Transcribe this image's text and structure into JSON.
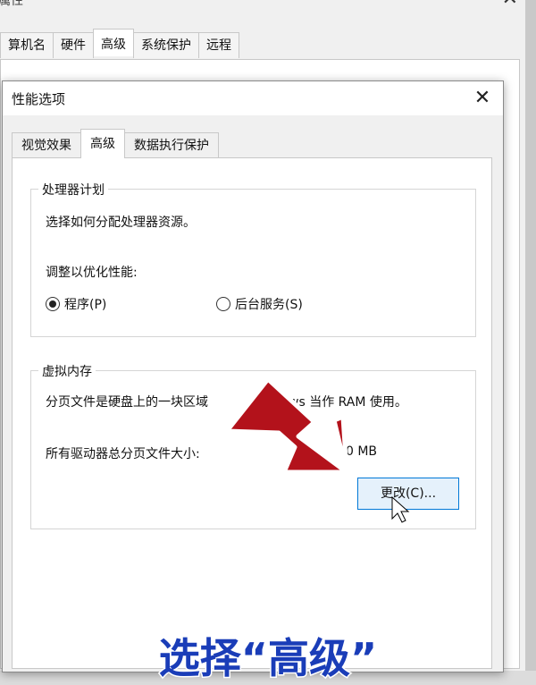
{
  "background_window": {
    "title": "属性",
    "close": "✕",
    "tabs": [
      "算机名",
      "硬件",
      "高级",
      "系统保护",
      "远程"
    ],
    "active_tab": 2
  },
  "dialog": {
    "title": "性能选项",
    "close": "✕",
    "tabs": [
      "视觉效果",
      "高级",
      "数据执行保护"
    ],
    "active_tab": 1
  },
  "processor": {
    "legend": "处理器计划",
    "desc": "选择如何分配处理器资源。",
    "adjust_label": "调整以优化性能:",
    "options": [
      {
        "label": "程序(P)",
        "checked": true
      },
      {
        "label": "后台服务(S)",
        "checked": false
      }
    ]
  },
  "vmem": {
    "legend": "虚拟内存",
    "desc_left": "分页文件是硬盘上的一块区域",
    "desc_right": "ws 当作 RAM 使用。",
    "total_label": "所有驱动器总分页文件大小:",
    "total_value": "0 MB",
    "change_button": "更改(C)..."
  },
  "overlay": {
    "caption": "选择“高级”",
    "arrow_color": "#b3121b"
  }
}
